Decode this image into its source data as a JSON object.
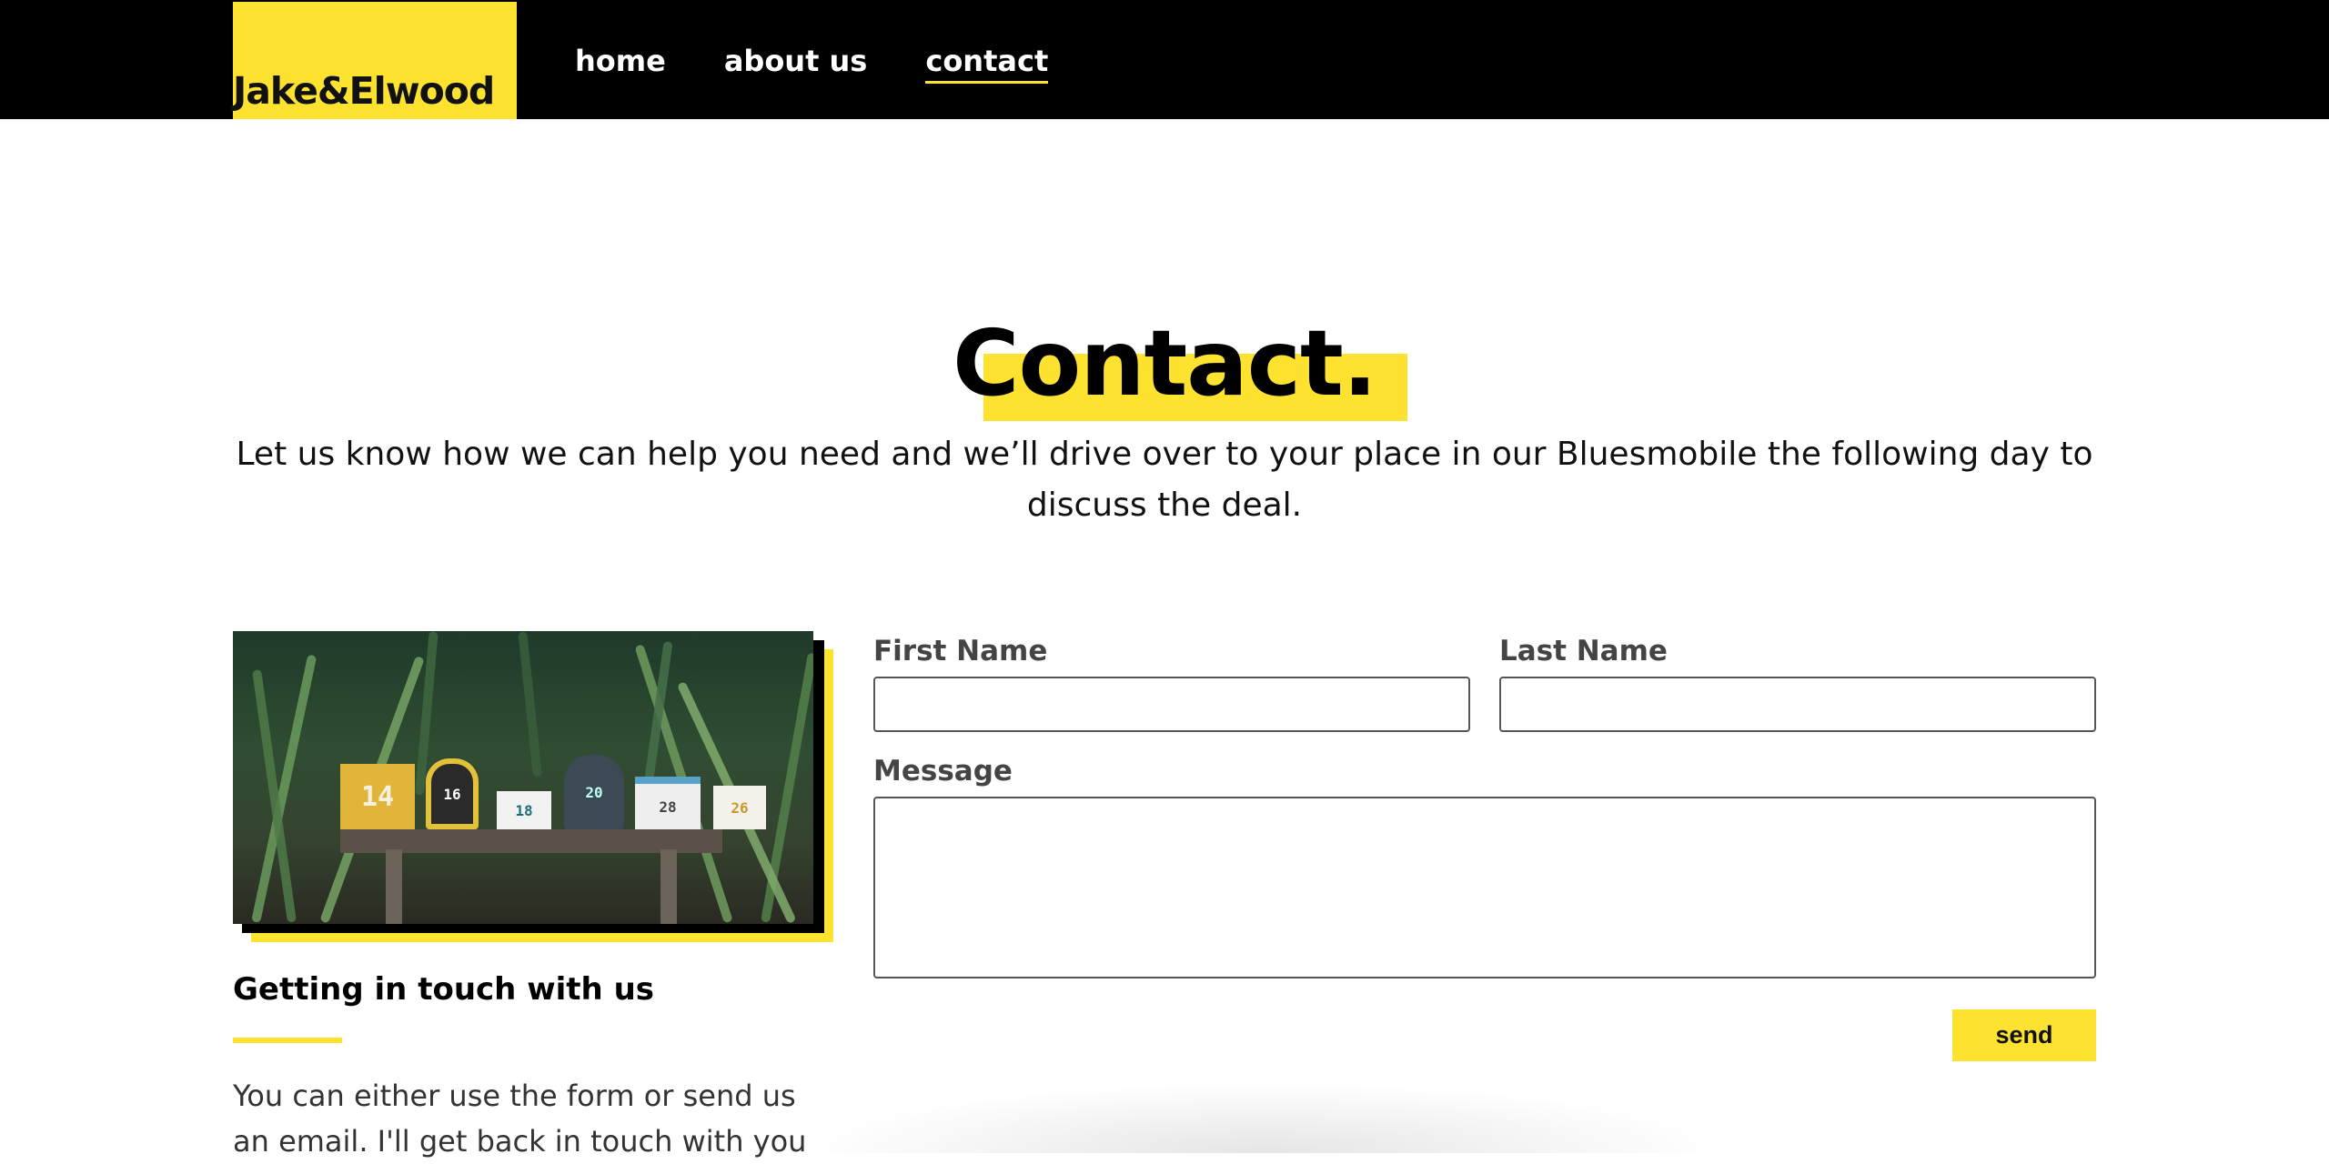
{
  "brand": {
    "logo_text": "Jake&Elwood",
    "accent": "#fde330",
    "header_bg": "#000000"
  },
  "nav": {
    "items": [
      {
        "label": "home",
        "active": false
      },
      {
        "label": "about us",
        "active": false
      },
      {
        "label": "contact",
        "active": true
      }
    ]
  },
  "hero": {
    "title": "Contact.",
    "subtitle": "Let us know how we can help you need and we’ll drive over to your place in our Bluesmobile the following day to discuss the deal."
  },
  "aside": {
    "image_alt": "Row of numbered mailboxes on a wooden stand in front of green plants",
    "mailbox_numbers": [
      "14",
      "16",
      "18",
      "20",
      "28",
      "26"
    ],
    "title": "Getting in touch with us",
    "body": "You can either use the form or send us an email. I'll get back in touch with you"
  },
  "form": {
    "first_name_label": "First Name",
    "first_name_value": "",
    "last_name_label": "Last Name",
    "last_name_value": "",
    "message_label": "Message",
    "message_value": "",
    "send_label": "send"
  }
}
